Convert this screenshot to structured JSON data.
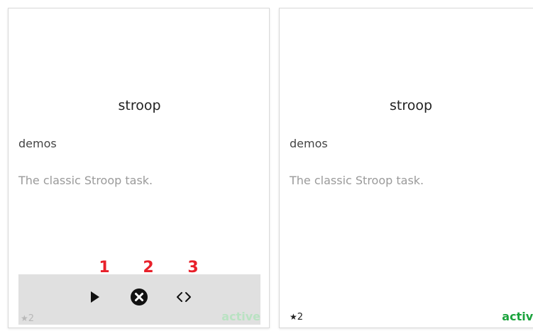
{
  "cards": [
    {
      "title": "stroop",
      "category": "demos",
      "description": "The classic Stroop task.",
      "stars": "2",
      "status": "active",
      "hover_actions": [
        {
          "icon": "play-icon",
          "step": "1"
        },
        {
          "icon": "close-circle-icon",
          "step": "2"
        },
        {
          "icon": "code-icon",
          "step": "3"
        }
      ]
    },
    {
      "title": "stroop",
      "category": "demos",
      "description": "The classic Stroop task.",
      "stars": "2",
      "status": "active"
    }
  ],
  "colors": {
    "status_active": "#1aa33c",
    "step_label": "#e8202a",
    "overlay_bg": "#e0e0e0"
  }
}
